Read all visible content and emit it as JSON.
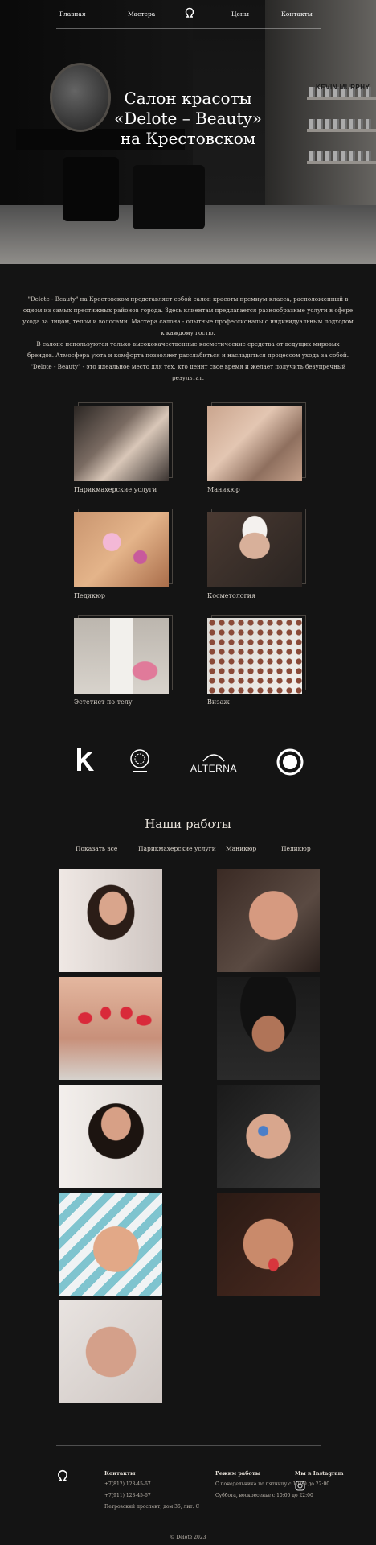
{
  "nav": {
    "items": [
      "Главная",
      "Мастера",
      "Цены",
      "Контакты"
    ]
  },
  "hero": {
    "title_line1": "Салон красоты",
    "title_line2": "«Delote – Beauty»",
    "title_line3": "на Крестовском",
    "sign_text": "KEVIN.MURPHY"
  },
  "intro": {
    "paragraph1": "\"Delote - Beauty\" на Крестовском представляет собой салон красоты премиум-класса, расположенный в одном из самых престижных районов города. Здесь клиентам предлагается разнообразные услуги в сфере ухода за лицом, телом и волосами. Мастера салона - опытные профессионалы с индивидуальным подходом к каждому гостю.",
    "paragraph2": "В салоне используются только высококачественные косметические средства от ведущих мировых брендов. Атмосфера уюта и комфорта позволяет расслабиться и насладиться процессом ухода за собой. \"Delote - Beauty\" - это идеальное место для тех, кто ценит свое время и желает получить безупречный результат."
  },
  "services": [
    {
      "label": "Парикмахерские услуги"
    },
    {
      "label": "Маникюр"
    },
    {
      "label": "Педикюр"
    },
    {
      "label": "Косметология"
    },
    {
      "label": "Эстетист по телу"
    },
    {
      "label": "Визаж"
    }
  ],
  "brands": [
    "K",
    "ORIBE",
    "ALTERNA",
    "DAVINES"
  ],
  "works": {
    "title": "Наши работы",
    "filters": [
      "Показать все",
      "Парикмахерские услуги",
      "Маникюр",
      "Педикюр"
    ]
  },
  "footer": {
    "contacts_title": "Контакты",
    "phone1": "+7(812) 123-45-67",
    "phone2": "+7(911) 123-45-67",
    "address": "Петровский проспект, дом 36, лит. С",
    "hours_title": "Режим работы",
    "hours1": "С понедельника по пятницу с 10:00 до 22:00",
    "hours2": "Суббота, воскресенье с 10:00 до 22:00",
    "social_title": "Мы в Instagram",
    "copyright": "© Delote 2023"
  }
}
